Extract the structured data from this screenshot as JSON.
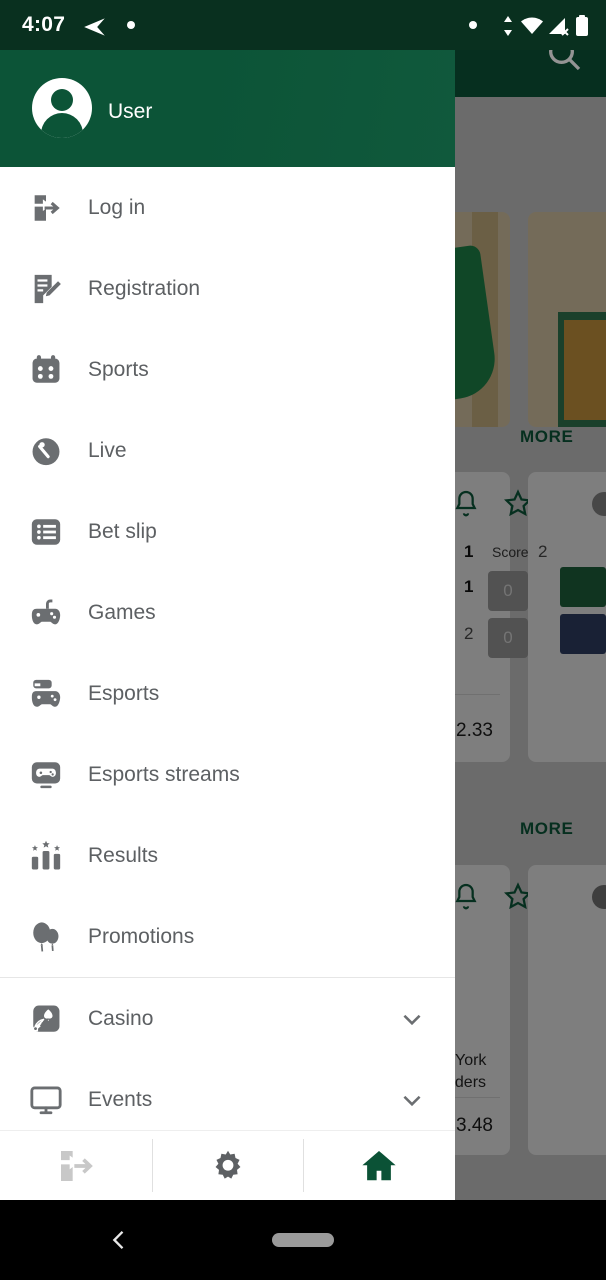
{
  "statusbar": {
    "time": "4:07",
    "icons": [
      "send-icon",
      "dot-icon",
      "dot-icon",
      "updown-arrows-icon",
      "wifi-icon",
      "signal-off-icon",
      "battery-icon"
    ]
  },
  "drawer": {
    "username": "User",
    "avatar_icon": "user-avatar-icon",
    "items": [
      {
        "label": "Log in",
        "icon": "login-icon",
        "chevron": false
      },
      {
        "label": "Registration",
        "icon": "registration-icon",
        "chevron": false
      },
      {
        "label": "Sports",
        "icon": "sports-icon",
        "chevron": false
      },
      {
        "label": "Live",
        "icon": "live-clock-icon",
        "chevron": false
      },
      {
        "label": "Bet slip",
        "icon": "betslip-list-icon",
        "chevron": false
      },
      {
        "label": "Games",
        "icon": "games-gamepad-icon",
        "chevron": false
      },
      {
        "label": "Esports",
        "icon": "esports-icon",
        "chevron": false
      },
      {
        "label": "Esports streams",
        "icon": "esports-streams-icon",
        "chevron": false
      },
      {
        "label": "Results",
        "icon": "results-podium-icon",
        "chevron": false
      },
      {
        "label": "Promotions",
        "icon": "promotions-balloons-icon",
        "chevron": false
      },
      {
        "label": "Casino",
        "icon": "casino-icon",
        "chevron": true
      },
      {
        "label": "Events",
        "icon": "events-monitor-icon",
        "chevron": true
      }
    ]
  },
  "bottombar": {
    "buttons": [
      {
        "name": "logout-button",
        "icon": "logout-icon",
        "color": "#c8c8c8"
      },
      {
        "name": "settings-button",
        "icon": "gear-icon",
        "color": "#5d6063"
      },
      {
        "name": "home-button",
        "icon": "home-icon",
        "color": "#0b5236"
      }
    ]
  },
  "background": {
    "appbar": {
      "search_icon": "search-icon",
      "color": "#0b5236"
    },
    "more_labels": [
      "MORE",
      "MORE"
    ],
    "cards": [
      {
        "bell_icon": "bell-icon",
        "star_icon": "star-icon",
        "score_header": "Score",
        "period": "1",
        "rows": [
          {
            "num": "1",
            "score": "0"
          },
          {
            "num": "2",
            "score": "0"
          }
        ],
        "odd": "2.33"
      },
      {
        "bell_icon": "bell-icon",
        "star_icon": "star-icon",
        "period": "2",
        "odd": ""
      },
      {
        "bell_icon": "bell-icon",
        "star_icon": "star-icon",
        "team_line1": "York",
        "team_line2": "nders",
        "odd": "3.48"
      }
    ]
  },
  "navbar": {
    "back_icon": "back-chevron-icon",
    "pill_icon": "home-pill-icon"
  }
}
